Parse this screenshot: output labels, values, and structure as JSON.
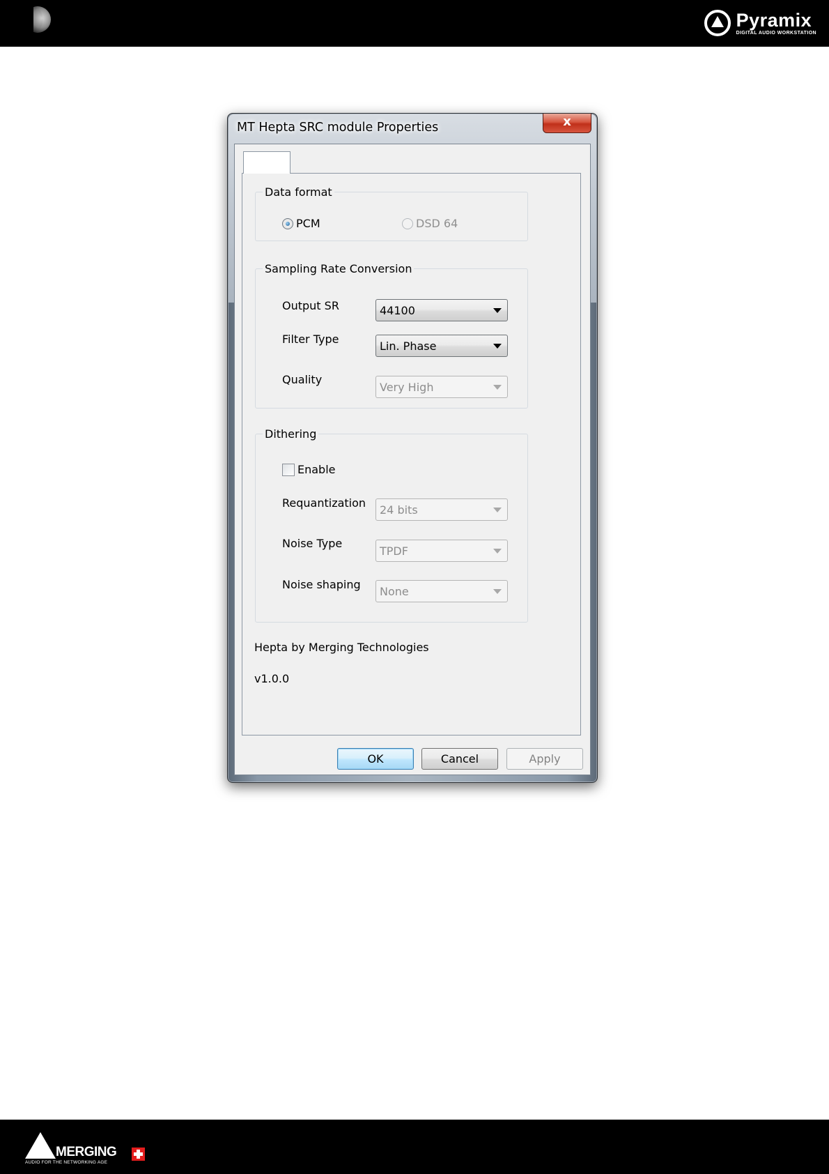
{
  "dialog": {
    "title": "MT Hepta SRC module Properties",
    "close_label": "x",
    "tab_label": ""
  },
  "data_format": {
    "label": "Data format",
    "options": [
      {
        "label": "PCM",
        "selected": true,
        "enabled": true
      },
      {
        "label": "DSD 64",
        "selected": false,
        "enabled": false
      }
    ]
  },
  "sampling_rate_conversion": {
    "label": "Sampling Rate Conversion",
    "output_sr": {
      "label": "Output SR",
      "value": "44100",
      "enabled": true
    },
    "filter_type": {
      "label": "Filter Type",
      "value": "Lin. Phase",
      "enabled": true
    },
    "quality": {
      "label": "Quality",
      "value": "Very High",
      "enabled": false
    }
  },
  "dithering": {
    "label": "Dithering",
    "enable": {
      "label": "Enable",
      "checked": false
    },
    "requantization": {
      "label": "Requantization",
      "value": "24 bits",
      "enabled": false
    },
    "noise_type": {
      "label": "Noise Type",
      "value": "TPDF",
      "enabled": false
    },
    "noise_shaping": {
      "label": "Noise shaping",
      "value": "None",
      "enabled": false
    }
  },
  "info": {
    "vendor": "Hepta by Merging Technologies",
    "version": "v1.0.0"
  },
  "buttons": {
    "ok": "OK",
    "cancel": "Cancel",
    "apply": "Apply"
  },
  "branding": {
    "header_name": "Pyramix",
    "header_sub": "DIGITAL AUDIO WORKSTATION",
    "footer_name": "MERGING",
    "footer_tag": "AUDIO FOR THE NETWORKING AGE"
  },
  "colors": {
    "band": "#000000",
    "dialog_face": "#f0f0f0",
    "close_button": "#c7432e",
    "default_button": "#bee6fd"
  }
}
